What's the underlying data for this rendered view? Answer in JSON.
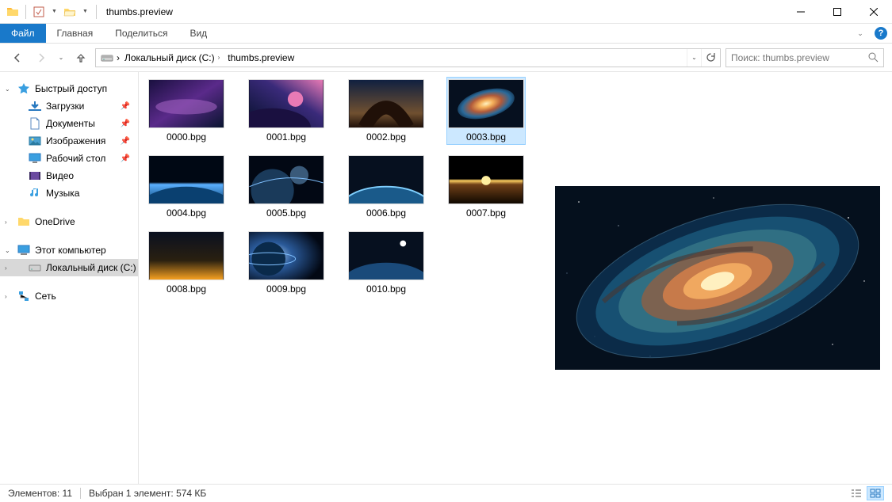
{
  "window": {
    "title": "thumbs.preview"
  },
  "ribbon": {
    "file": "Файл",
    "home": "Главная",
    "share": "Поделиться",
    "view": "Вид"
  },
  "address": {
    "root": "Локальный диск (C:)",
    "folder": "thumbs.preview"
  },
  "search": {
    "placeholder": "Поиск: thumbs.preview"
  },
  "nav": {
    "quick_access": "Быстрый доступ",
    "downloads": "Загрузки",
    "documents": "Документы",
    "pictures": "Изображения",
    "desktop": "Рабочий стол",
    "videos": "Видео",
    "music": "Музыка",
    "onedrive": "OneDrive",
    "this_pc": "Этот компьютер",
    "local_disk": "Локальный диск (C:)",
    "network": "Сеть"
  },
  "files": [
    "0000.bpg",
    "0001.bpg",
    "0002.bpg",
    "0003.bpg",
    "0004.bpg",
    "0005.bpg",
    "0006.bpg",
    "0007.bpg",
    "0008.bpg",
    "0009.bpg",
    "0010.bpg"
  ],
  "selected_index": 3,
  "status": {
    "count": "Элементов: 11",
    "selection": "Выбран 1 элемент: 574 КБ"
  }
}
